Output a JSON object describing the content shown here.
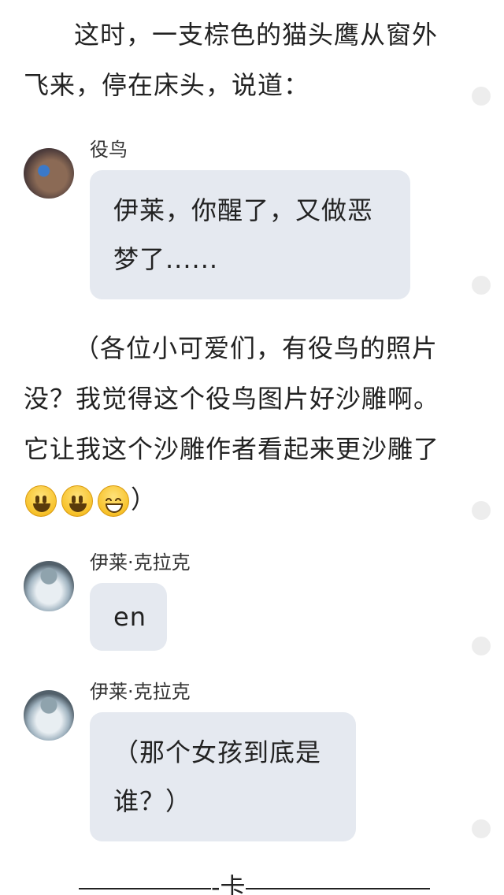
{
  "story": {
    "para1": "这时，一支棕色的猫头鹰从窗外飞来，停在床头，说道：",
    "para2_text": "（各位小可爱们，有役鸟的照片没？我觉得这个役鸟图片好沙雕啊。它让我这个沙雕作者看起来更沙雕了",
    "para2_end": "）",
    "para2_emojis": [
      "smiley-icon",
      "smiley-icon",
      "grin-icon"
    ]
  },
  "messages": [
    {
      "sender": "役鸟",
      "text": "伊莱，你醒了，又做恶梦了......",
      "avatar": "owl-avatar"
    },
    {
      "sender": "伊莱·克拉克",
      "text": "en",
      "avatar": "eli-avatar"
    },
    {
      "sender": "伊莱·克拉克",
      "text": "（那个女孩到底是谁？）",
      "avatar": "eli-avatar"
    }
  ],
  "divider": {
    "text": "-卡"
  },
  "colors": {
    "bubble": "#e5e9f0",
    "text": "#222222",
    "scroll_dot": "#ededed"
  }
}
